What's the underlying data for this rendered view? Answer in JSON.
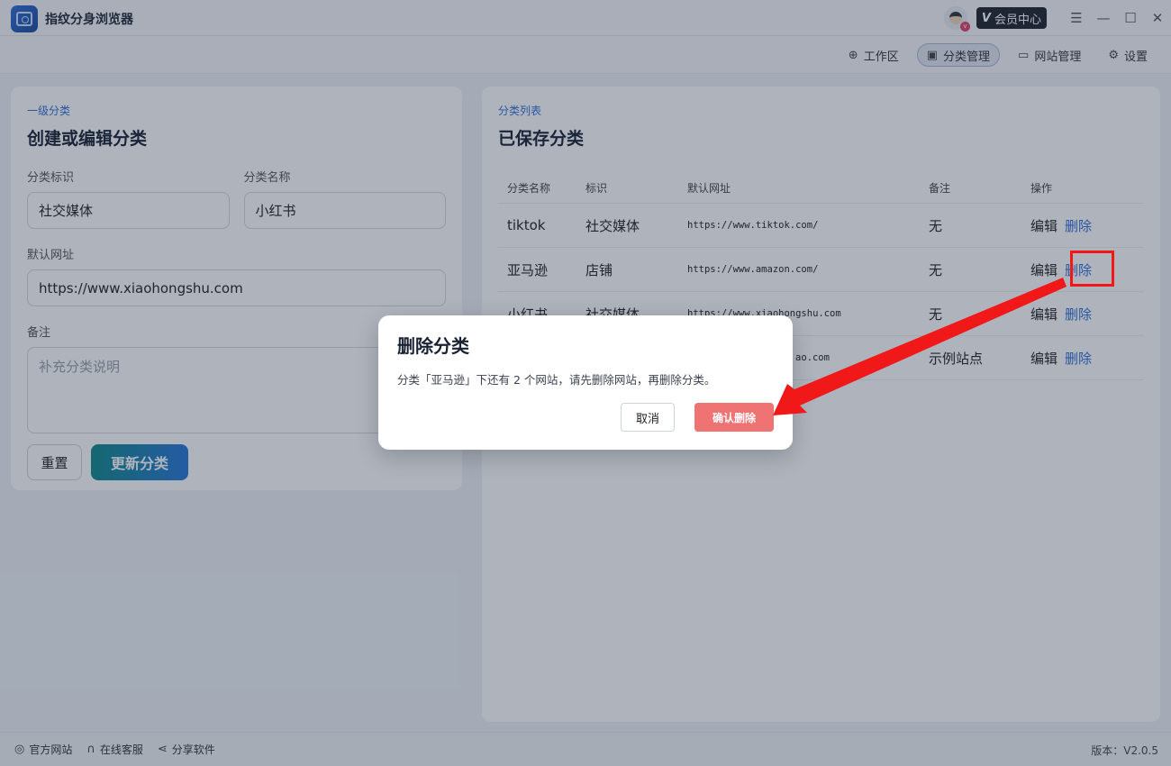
{
  "app": {
    "title": "指纹分身浏览器",
    "vip_label": "会员中心",
    "vip_letter": "V"
  },
  "nav": {
    "items": [
      {
        "label": "工作区",
        "icon": "globe-icon"
      },
      {
        "label": "分类管理",
        "icon": "layout-icon"
      },
      {
        "label": "网站管理",
        "icon": "monitor-icon"
      },
      {
        "label": "设置",
        "icon": "settings-icon"
      }
    ],
    "active": "分类管理"
  },
  "form": {
    "sublabel": "一级分类",
    "title": "创建或编辑分类",
    "id_label": "分类标识",
    "id_value": "社交媒体",
    "name_label": "分类名称",
    "name_value": "小红书",
    "url_label": "默认网址",
    "url_value": "https://www.xiaohongshu.com",
    "note_label": "备注",
    "note_placeholder": "补充分类说明",
    "reset_label": "重置",
    "update_label": "更新分类"
  },
  "list": {
    "sublabel": "分类列表",
    "title": "已保存分类",
    "headers": [
      "分类名称",
      "标识",
      "默认网址",
      "备注",
      "操作"
    ],
    "edit_label": "编辑",
    "delete_label": "删除",
    "rows": [
      {
        "name": "tiktok",
        "tag": "社交媒体",
        "url": "https://www.tiktok.com/",
        "note": "无"
      },
      {
        "name": "亚马逊",
        "tag": "店铺",
        "url": "https://www.amazon.com/",
        "note": "无"
      },
      {
        "name": "小红书",
        "tag": "社交媒体",
        "url": "https://www.xiaohongshu.com",
        "note": "无"
      },
      {
        "name": "",
        "tag": "",
        "url": "ao.com",
        "note": "示例站点"
      }
    ]
  },
  "modal": {
    "title": "删除分类",
    "message": "分类「亚马逊」下还有 2 个网站，请先删除网站，再删除分类。",
    "cancel_label": "取消",
    "confirm_label": "确认删除"
  },
  "footer": {
    "items": [
      {
        "label": "官方网站",
        "icon": "planet-icon"
      },
      {
        "label": "在线客服",
        "icon": "headset-icon"
      },
      {
        "label": "分享软件",
        "icon": "share-icon"
      }
    ],
    "version": "版本：V2.0.5"
  },
  "colors": {
    "accent": "#2f6fd6",
    "danger": "#ef7373",
    "highlight": "#f01818"
  }
}
